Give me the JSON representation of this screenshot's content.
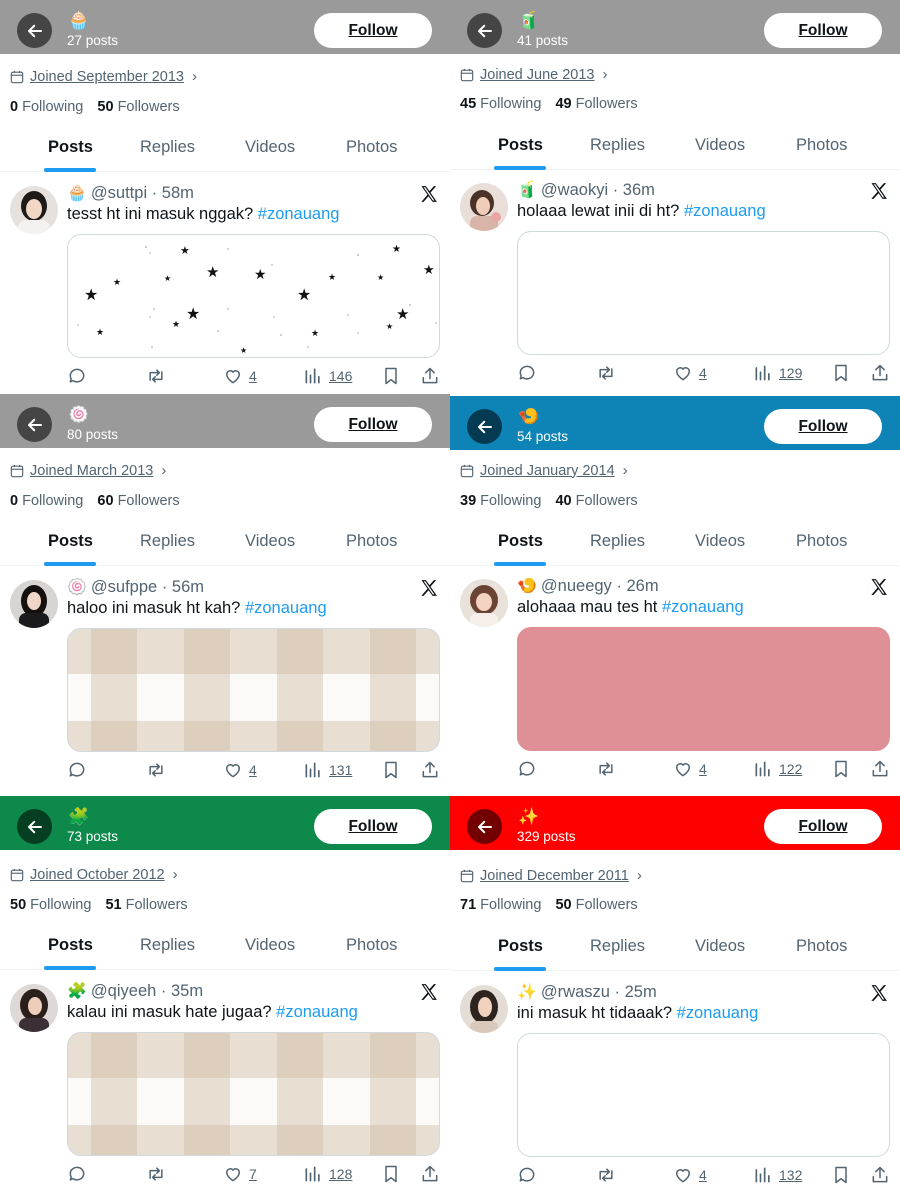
{
  "colors": {
    "grey": "#9a9a9a",
    "teal": "#0d84b5",
    "green": "#0d8a4b",
    "red": "#ff0000",
    "link": "#1d9bf0",
    "pink_media": "#df8f96"
  },
  "tab_labels": [
    "Posts",
    "Replies",
    "Videos",
    "Photos"
  ],
  "panels": [
    {
      "header_emoji": "🧁",
      "posts_count": "27 posts",
      "follow_label": "Follow",
      "joined": "Joined September 2013",
      "following_count": "0",
      "following_label": "Following",
      "followers_count": "50",
      "followers_label": "Followers",
      "tweet": {
        "emoji": "🧁",
        "handle": "@suttpi",
        "separator": "·",
        "time": "58m",
        "text": "tesst ht ini masuk nggak?",
        "hashtag": "#zonauang",
        "media": "stars",
        "likes": "4",
        "views": "146"
      }
    },
    {
      "header_emoji": "🧃",
      "posts_count": "41 posts",
      "follow_label": "Follow",
      "joined": "Joined June 2013",
      "following_count": "45",
      "following_label": "Following",
      "followers_count": "49",
      "followers_label": "Followers",
      "tweet": {
        "emoji": "🧃",
        "handle": "@waokyi",
        "separator": "·",
        "time": "36m",
        "text": "holaaa lewat inii di ht?",
        "hashtag": "#zonauang",
        "media": "blank",
        "likes": "4",
        "views": "129"
      }
    },
    {
      "header_emoji": "🍥",
      "posts_count": "80 posts",
      "follow_label": "Follow",
      "joined": "Joined March 2013",
      "following_count": "0",
      "following_label": "Following",
      "followers_count": "60",
      "followers_label": "Followers",
      "tweet": {
        "emoji": "🍥",
        "handle": "@sufppe",
        "separator": "·",
        "time": "56m",
        "text": "haloo ini masuk ht kah?",
        "hashtag": "#zonauang",
        "media": "plaid",
        "likes": "4",
        "views": "131"
      }
    },
    {
      "header_emoji": "🍤",
      "posts_count": "54 posts",
      "follow_label": "Follow",
      "joined": "Joined January 2014",
      "following_count": "39",
      "following_label": "Following",
      "followers_count": "40",
      "followers_label": "Followers",
      "tweet": {
        "emoji": "🍤",
        "handle": "@nueegy",
        "separator": "·",
        "time": "26m",
        "text": "alohaaa mau tes ht",
        "hashtag": "#zonauang",
        "media": "pink",
        "likes": "4",
        "views": "122"
      }
    },
    {
      "header_emoji": "🧩",
      "posts_count": "73 posts",
      "follow_label": "Follow",
      "joined": "Joined October 2012",
      "following_count": "50",
      "following_label": "Following",
      "followers_count": "51",
      "followers_label": "Followers",
      "tweet": {
        "emoji": "🧩",
        "handle": "@qiyeeh",
        "separator": "·",
        "time": "35m",
        "text": "kalau ini masuk hate jugaa?",
        "hashtag": "#zonauang",
        "media": "plaid",
        "likes": "7",
        "views": "128"
      }
    },
    {
      "header_emoji": "✨",
      "posts_count": "329 posts",
      "follow_label": "Follow",
      "joined": "Joined December 2011",
      "following_count": "71",
      "following_label": "Following",
      "followers_count": "50",
      "followers_label": "Followers",
      "tweet": {
        "emoji": "✨",
        "handle": "@rwaszu",
        "separator": "·",
        "time": "25m",
        "text": "ini masuk ht tidaaak?",
        "hashtag": "#zonauang",
        "media": "blank",
        "likes": "4",
        "views": "132"
      }
    }
  ]
}
